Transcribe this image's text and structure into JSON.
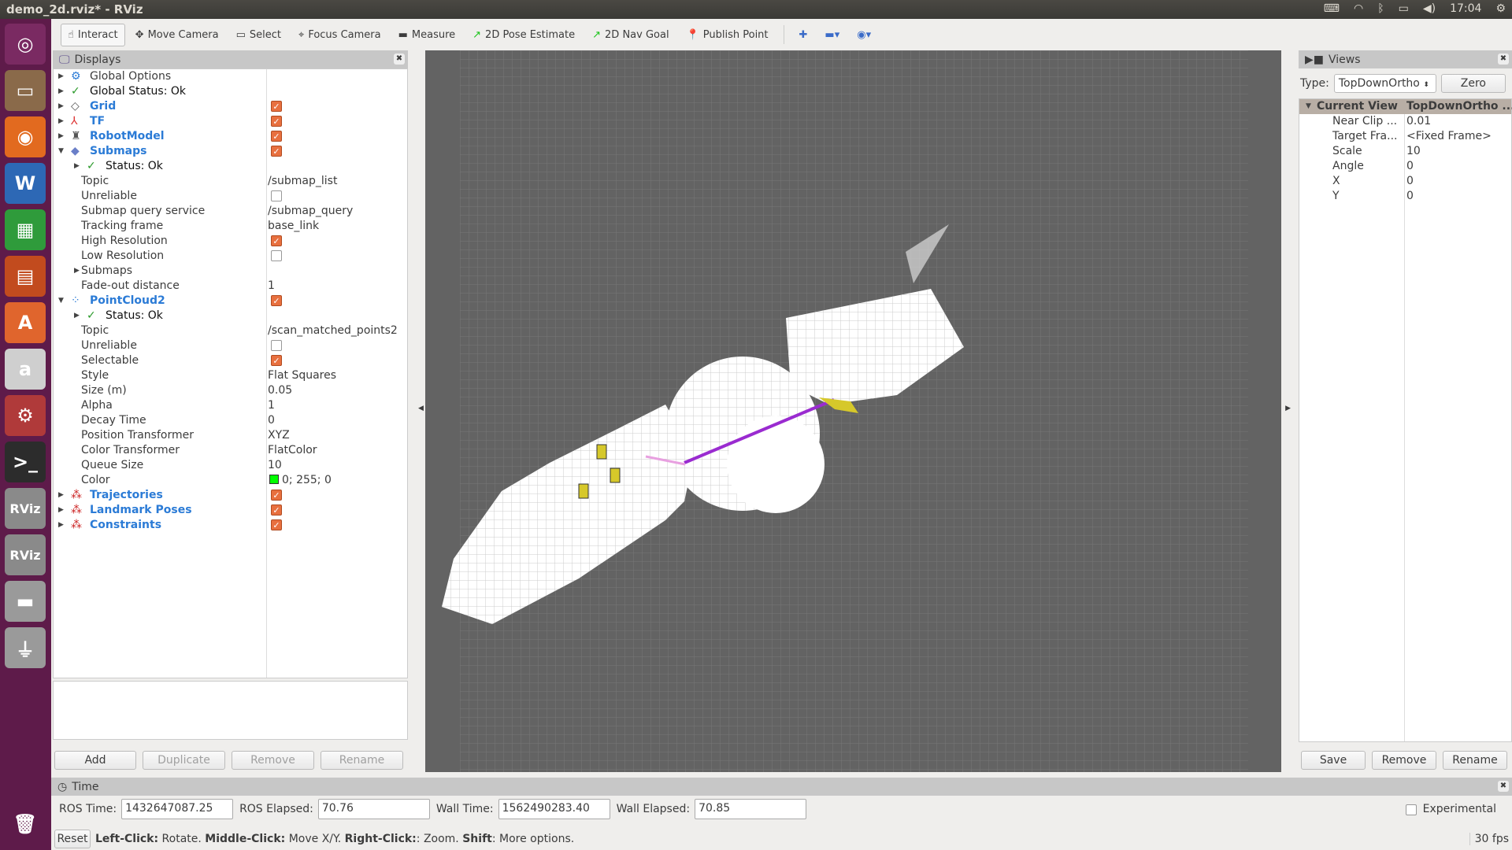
{
  "window": {
    "title": "demo_2d.rviz* - RViz",
    "clock": "17:04"
  },
  "tray_icons": [
    "keyboard-icon",
    "wifi-icon",
    "bluetooth-icon",
    "battery-icon",
    "volume-icon"
  ],
  "launcher": [
    {
      "icon": "ubuntu-dash-icon",
      "label": "◎",
      "color": "#7a2a62"
    },
    {
      "icon": "files-icon",
      "label": "▭",
      "color": "#8a6a4a"
    },
    {
      "icon": "firefox-icon",
      "label": "◉",
      "color": "#e26a1f"
    },
    {
      "icon": "writer-icon",
      "label": "W",
      "color": "#2d68b5"
    },
    {
      "icon": "calc-icon",
      "label": "▦",
      "color": "#2f9b3b"
    },
    {
      "icon": "impress-icon",
      "label": "▤",
      "color": "#c24b1e"
    },
    {
      "icon": "software-center-icon",
      "label": "A",
      "color": "#e0652d"
    },
    {
      "icon": "amazon-icon",
      "label": "a",
      "color": "#cfcfcf"
    },
    {
      "icon": "settings-icon",
      "label": "⚙",
      "color": "#b03a3a"
    },
    {
      "icon": "terminal-icon",
      "label": ">_",
      "color": "#2c2c2c"
    },
    {
      "icon": "rviz-icon",
      "label": "RViz",
      "color": "#8a8a8a"
    },
    {
      "icon": "rviz-icon",
      "label": "RViz",
      "color": "#8a8a8a"
    },
    {
      "icon": "drive-icon",
      "label": "▬",
      "color": "#9a9a9a"
    },
    {
      "icon": "usb-icon",
      "label": "⏚",
      "color": "#9a9a9a"
    }
  ],
  "launcher_trash": {
    "icon": "trash-icon",
    "label": "🗑"
  },
  "toolbar": [
    {
      "label": "Interact",
      "icon": "hand-icon",
      "glyph": "☝",
      "active": true
    },
    {
      "label": "Move Camera",
      "icon": "move-camera-icon",
      "glyph": "✥"
    },
    {
      "label": "Select",
      "icon": "select-icon",
      "glyph": "▭"
    },
    {
      "label": "Focus Camera",
      "icon": "focus-camera-icon",
      "glyph": "⌖"
    },
    {
      "label": "Measure",
      "icon": "ruler-icon",
      "glyph": "▬"
    },
    {
      "label": "2D Pose Estimate",
      "icon": "green-arrow-icon",
      "glyph": "↗"
    },
    {
      "label": "2D Nav Goal",
      "icon": "green-arrow-icon",
      "glyph": "↗"
    },
    {
      "label": "Publish Point",
      "icon": "pin-icon",
      "glyph": "📍"
    }
  ],
  "toolbar_extras": [
    {
      "icon": "add-tool-icon",
      "glyph": "✚"
    },
    {
      "icon": "remove-tool-icon",
      "glyph": "▬▾"
    },
    {
      "icon": "camera-type-icon",
      "glyph": "◉▾"
    }
  ],
  "displays": {
    "title": "Displays",
    "rows": [
      {
        "d": 0,
        "arrow": "▶",
        "icon": "⚙",
        "iconColor": "#2b7bd6",
        "name": "Global Options"
      },
      {
        "d": 0,
        "arrow": "▶",
        "icon": "✓",
        "iconColor": "#2a9a2a",
        "name": "Global Status: Ok"
      },
      {
        "d": 0,
        "arrow": "▶",
        "icon": "◇",
        "iconColor": "#555",
        "name": "Grid",
        "blue": true,
        "check": true
      },
      {
        "d": 0,
        "arrow": "▶",
        "icon": "⅄",
        "iconColor": "#d33",
        "name": "TF",
        "blue": true,
        "check": true
      },
      {
        "d": 0,
        "arrow": "▶",
        "icon": "♜",
        "iconColor": "#555",
        "name": "RobotModel",
        "blue": true,
        "check": true
      },
      {
        "d": 0,
        "arrow": "▼",
        "icon": "◆",
        "iconColor": "#6a7fc8",
        "name": "Submaps",
        "blue": true,
        "check": true
      },
      {
        "d": 1,
        "arrow": "▶",
        "icon": "✓",
        "iconColor": "#2a9a2a",
        "name": "Status: Ok"
      },
      {
        "d": 2,
        "name": "Topic",
        "value": "/submap_list"
      },
      {
        "d": 2,
        "name": "Unreliable",
        "check": false
      },
      {
        "d": 2,
        "name": "Submap query service",
        "value": "/submap_query"
      },
      {
        "d": 2,
        "name": "Tracking frame",
        "value": "base_link"
      },
      {
        "d": 2,
        "name": "High Resolution",
        "check": true
      },
      {
        "d": 2,
        "name": "Low Resolution",
        "check": false
      },
      {
        "d": 2,
        "arrow": "▶",
        "name": "Submaps"
      },
      {
        "d": 2,
        "name": "Fade-out distance",
        "value": "1"
      },
      {
        "d": 0,
        "arrow": "▼",
        "icon": "⁘",
        "iconColor": "#2b7bd6",
        "name": "PointCloud2",
        "blue": true,
        "check": true
      },
      {
        "d": 1,
        "arrow": "▶",
        "icon": "✓",
        "iconColor": "#2a9a2a",
        "name": "Status: Ok"
      },
      {
        "d": 2,
        "name": "Topic",
        "value": "/scan_matched_points2"
      },
      {
        "d": 2,
        "name": "Unreliable",
        "check": false
      },
      {
        "d": 2,
        "name": "Selectable",
        "check": true
      },
      {
        "d": 2,
        "name": "Style",
        "value": "Flat Squares"
      },
      {
        "d": 2,
        "name": "Size (m)",
        "value": "0.05"
      },
      {
        "d": 2,
        "name": "Alpha",
        "value": "1"
      },
      {
        "d": 2,
        "name": "Decay Time",
        "value": "0"
      },
      {
        "d": 2,
        "name": "Position Transformer",
        "value": "XYZ"
      },
      {
        "d": 2,
        "name": "Color Transformer",
        "value": "FlatColor"
      },
      {
        "d": 2,
        "name": "Queue Size",
        "value": "10"
      },
      {
        "d": 2,
        "name": "Color",
        "value": "0; 255; 0",
        "swatch": "#00ff00"
      },
      {
        "d": 0,
        "arrow": "▶",
        "icon": "⁂",
        "iconColor": "#c22",
        "name": "Trajectories",
        "blue": true,
        "check": true
      },
      {
        "d": 0,
        "arrow": "▶",
        "icon": "⁂",
        "iconColor": "#c22",
        "name": "Landmark Poses",
        "blue": true,
        "check": true
      },
      {
        "d": 0,
        "arrow": "▶",
        "icon": "⁂",
        "iconColor": "#c22",
        "name": "Constraints",
        "blue": true,
        "check": true
      }
    ],
    "buttons": {
      "add": "Add",
      "duplicate": "Duplicate",
      "remove": "Remove",
      "rename": "Rename"
    }
  },
  "views": {
    "title": "Views",
    "type_label": "Type:",
    "type_value": "TopDownOrtho",
    "zero": "Zero",
    "header": {
      "name": "Current View",
      "value": "TopDownOrtho ..."
    },
    "rows": [
      {
        "name": "Near Clip ...",
        "value": "0.01"
      },
      {
        "name": "Target Fra...",
        "value": "<Fixed Frame>"
      },
      {
        "name": "Scale",
        "value": "10"
      },
      {
        "name": "Angle",
        "value": "0"
      },
      {
        "name": "X",
        "value": "0"
      },
      {
        "name": "Y",
        "value": "0"
      }
    ],
    "buttons": {
      "save": "Save",
      "remove": "Remove",
      "rename": "Rename"
    }
  },
  "time": {
    "title": "Time",
    "ros_time_label": "ROS Time:",
    "ros_time": "1432647087.25",
    "ros_elapsed_label": "ROS Elapsed:",
    "ros_elapsed": "70.76",
    "wall_time_label": "Wall Time:",
    "wall_time": "1562490283.40",
    "wall_elapsed_label": "Wall Elapsed:",
    "wall_elapsed": "70.85",
    "experimental": "Experimental"
  },
  "status": {
    "reset": "Reset",
    "k1": "Left-Click:",
    "t1": " Rotate. ",
    "k2": "Middle-Click:",
    "t2": " Move X/Y. ",
    "k3": "Right-Click:",
    "t3": ": Zoom. ",
    "k4": "Shift",
    "t4": ": More options.",
    "fps": "30 fps"
  }
}
